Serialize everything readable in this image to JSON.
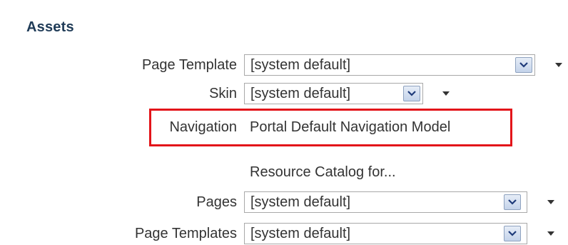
{
  "section": {
    "title": "Assets"
  },
  "rows": {
    "page_template": {
      "label": "Page Template",
      "value": "[system default]"
    },
    "skin": {
      "label": "Skin",
      "value": "[system default]"
    },
    "navigation": {
      "label": "Navigation",
      "value": "Portal Default Navigation Model"
    },
    "resource_catalog": {
      "heading": "Resource Catalog for..."
    },
    "pages": {
      "label": "Pages",
      "value": "[system default]"
    },
    "page_templates": {
      "label": "Page Templates",
      "value": "[system default]"
    }
  },
  "colors": {
    "title": "#1f3b57",
    "highlight": "#e3151a",
    "dropdown_button": "#c4d3ea"
  },
  "icons": {
    "dropdown": "chevron-down-icon",
    "menu": "caret-down-icon"
  }
}
